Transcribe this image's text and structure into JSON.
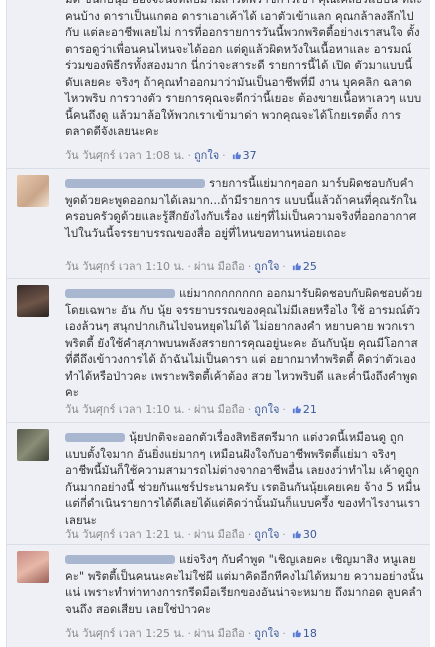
{
  "comments": [
    {
      "text": "มด ขึ้นกับนุ้ย ฮองจะนี่งหลบมามีสาร์ตพราชการเขา คุณเคลียร์แบบนี้ ทีละคนบ้าง ดาราเป็นแกตอ ดาราเอาเค้าได้ เอาตัวเข้าแลก คุณกล้าลงลึกไปกับ แต่ละอาชีพเลยไม่ การที่ออกรายการวันนี้พวกพริตตี้อย่างเราสนใจ ตั้งตารอดูว่าเพื่อนคนไหนจะได้ออก แต่ดูแล้วผิดหวังในเนื้อหาและ อารมณ์ร่วมของพิธีกรทั้งสองมาก นี่กว่าจะสาระดี รายการนี้ได้ เปิด ตัวมาแบบนี้ดับเลยคะ จริงๆ ถ้าคุณทำออกมาว่ามันเป็นอาชีพที่มี งาน บุคคลิก ฉลาด ไหวพริบ การวางตัว รายการคุณจะดีกว่านี้เยอะ ต้องขายเนื้อหาเลวๆ แบบนี้คนถึงดู แล้วมาล้อให้พวกเราเข้ามาด่า พวกคุณจะได้โกยเรตติ้ง การตลาดดีจังเลยนะคะ",
      "time": "วัน วันศุกร์ เวลา 1:08 น.",
      "via": "",
      "like_label": "ถูกใจ",
      "likes": "37"
    },
    {
      "text": "รายการนี้แย่มากๆออก มาร์บผิดชอบกับคำพูดด้วยคะพูดออกมาได้เลมาก...ถ้ามีรายการ แบบนี้แล้วถ้าคนที่คุณรักในครอบครัวดูด้วยและรู้สึกยังไงกับเรื่อง แย่ๆที่ไม่เป็นความจริงที่ออกอากาศไปในวันนี้จรรยาบรรณของสื่อ อยู่ที่ไหนขอทานหน่อยเถอะ",
      "time": "วัน วันศุกร์ เวลา 1:10 น.",
      "via": "ผ่าน มือถือ",
      "like_label": "ถูกใจ",
      "likes": "25"
    },
    {
      "text": "แย่มากกกกกกกก ออกมารับผิดชอบกับผิดชอบด้วย โดยเฉพาะ อัน กับ นุ้ย จรรยาบรรณของคุณไม่มีเลยหรือไง ใช้ อารมณ์ตัวเองล้วนๆ สนุกปากเกินไปจนหยุดไม่ได้ ไม่อยากลงคำ หยาบคาย พวกเราพริตตี้ ยังใช้คำสุภาพบนพลังสรายการคุณอยู่นะคะ อันกับนุ้ย คุณมีโอกาสที่ดีถึงเข้าวงการได้ ถ้าฉันไม่เป็นดารา แต่ อยากมาทำพริตตี้ คิดว่าตัวเองทำได้หรือป่าวคะ เพราะพริตตี้เค้าต้อง สวย ไหวพริบดี และค่ำนึงถึงคำพูดคะ",
      "time": "วัน วันศุกร์ เวลา 1:10 น.",
      "via": "ผ่าน มือถือ",
      "like_label": "ถูกใจ",
      "likes": "21"
    },
    {
      "text": "นุ้ยปกติจะออกตัวเรื่องสิทธิสตรีมาก แต่งวดนี้เหมือนดู ถูกแบบตั้งใจมาก อันยิ่งแย่มากๆ เหมือนฝังใจกับอาชีพพริตตี้แย่มา จริงๆอาชีพนี้มันก็ใช้ความสามารถไม่ต่างจากอาชีพอื่น เลยงงว่าทำไม เค้าดูถูกกันมากอย่างนี้ ช่วยกันแชร์ประนามครับ เรตอินกันนุ้ยเคยเคย จ้าง 5 หมื่น แต่กี่ดำเนินรายการได้ดีเลยได้แต่คิดว่านั้นมันก็แบบครึ้ง ของทำไรงานเราเลยนะ",
      "time": "วัน วันศุกร์ เวลา 1:21 น.",
      "via": "ผ่าน มือถือ",
      "like_label": "ถูกใจ",
      "likes": "30"
    },
    {
      "text": "แย่จริงๆ กับคำพูด \"เชิญเลยคะ เชิญมาสิง หนูเลยคะ\" พริตตี้เป็นคนนะคะไม่ใช่ผี แต่มาคิดอีกทีคงไม่ได้หมาย ความอย่างนั้นแน่ เพราะทำท่าทางการกรีดมือเรียกของอันน่าจะหมาย ถึงมากอด ลูบคลำ จนถึง สอดเสียบ เลยใช่ป่าวคะ",
      "time": "วัน วันศุกร์ เวลา 1:25 น.",
      "via": "ผ่าน มือถือ",
      "like_label": "ถูกใจ",
      "likes": "18"
    }
  ],
  "colors": {
    "link": "#3b5998",
    "meta": "#8a8a8a",
    "bg": "#eef0f5"
  }
}
